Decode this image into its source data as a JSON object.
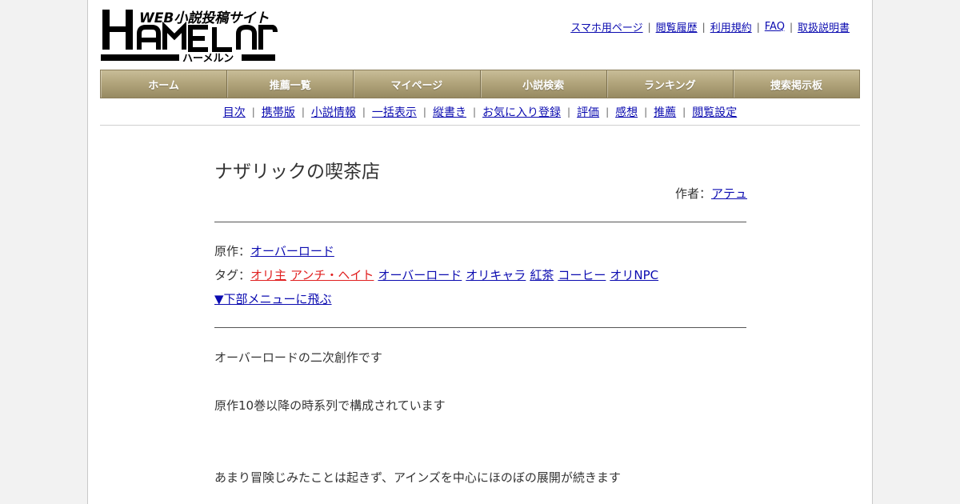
{
  "logo": {
    "main": "HAMELN",
    "tagline": "WEB小説投稿サイト",
    "kana": "ハーメルン"
  },
  "header_links": [
    "スマホ用ページ",
    "閲覧履歴",
    "利用規約",
    "FAQ",
    "取扱説明書"
  ],
  "main_nav": [
    "ホーム",
    "推薦一覧",
    "マイページ",
    "小説検索",
    "ランキング",
    "捜索掲示板"
  ],
  "sub_nav": [
    "目次",
    "携帯版",
    "小説情報",
    "一括表示",
    "縦書き",
    "お気に入り登録",
    "評価",
    "感想",
    "推薦",
    "閲覧設定"
  ],
  "novel": {
    "title": "ナザリックの喫茶店",
    "author_label": "作者：",
    "author_name": "アテュ",
    "original_label": "原作：",
    "original_work": "オーバーロード",
    "tags_label": "タグ：",
    "tags": [
      {
        "text": "オリ主",
        "color": "#e02020"
      },
      {
        "text": "アンチ・ヘイト",
        "color": "#e02020"
      },
      {
        "text": "オーバーロード",
        "color": "#0b0bb0"
      },
      {
        "text": "オリキャラ",
        "color": "#0b0bb0"
      },
      {
        "text": "紅茶",
        "color": "#0b0bb0"
      },
      {
        "text": "コーヒー",
        "color": "#0b0bb0"
      },
      {
        "text": "オリNPC",
        "color": "#0b0bb0"
      }
    ],
    "jump_link": "▼下部メニューに飛ぶ",
    "synopsis": [
      "オーバーロードの二次創作です",
      "原作10巻以降の時系列で構成されています",
      "あまり冒険じみたことは起きず、アインズを中心にほのぼの展開が続きます"
    ]
  },
  "colors": {
    "nav_gradient_top": "#c8bd98",
    "nav_gradient_bottom": "#978a62",
    "link": "#0b0bb0",
    "warning_tag": "#e02020"
  }
}
